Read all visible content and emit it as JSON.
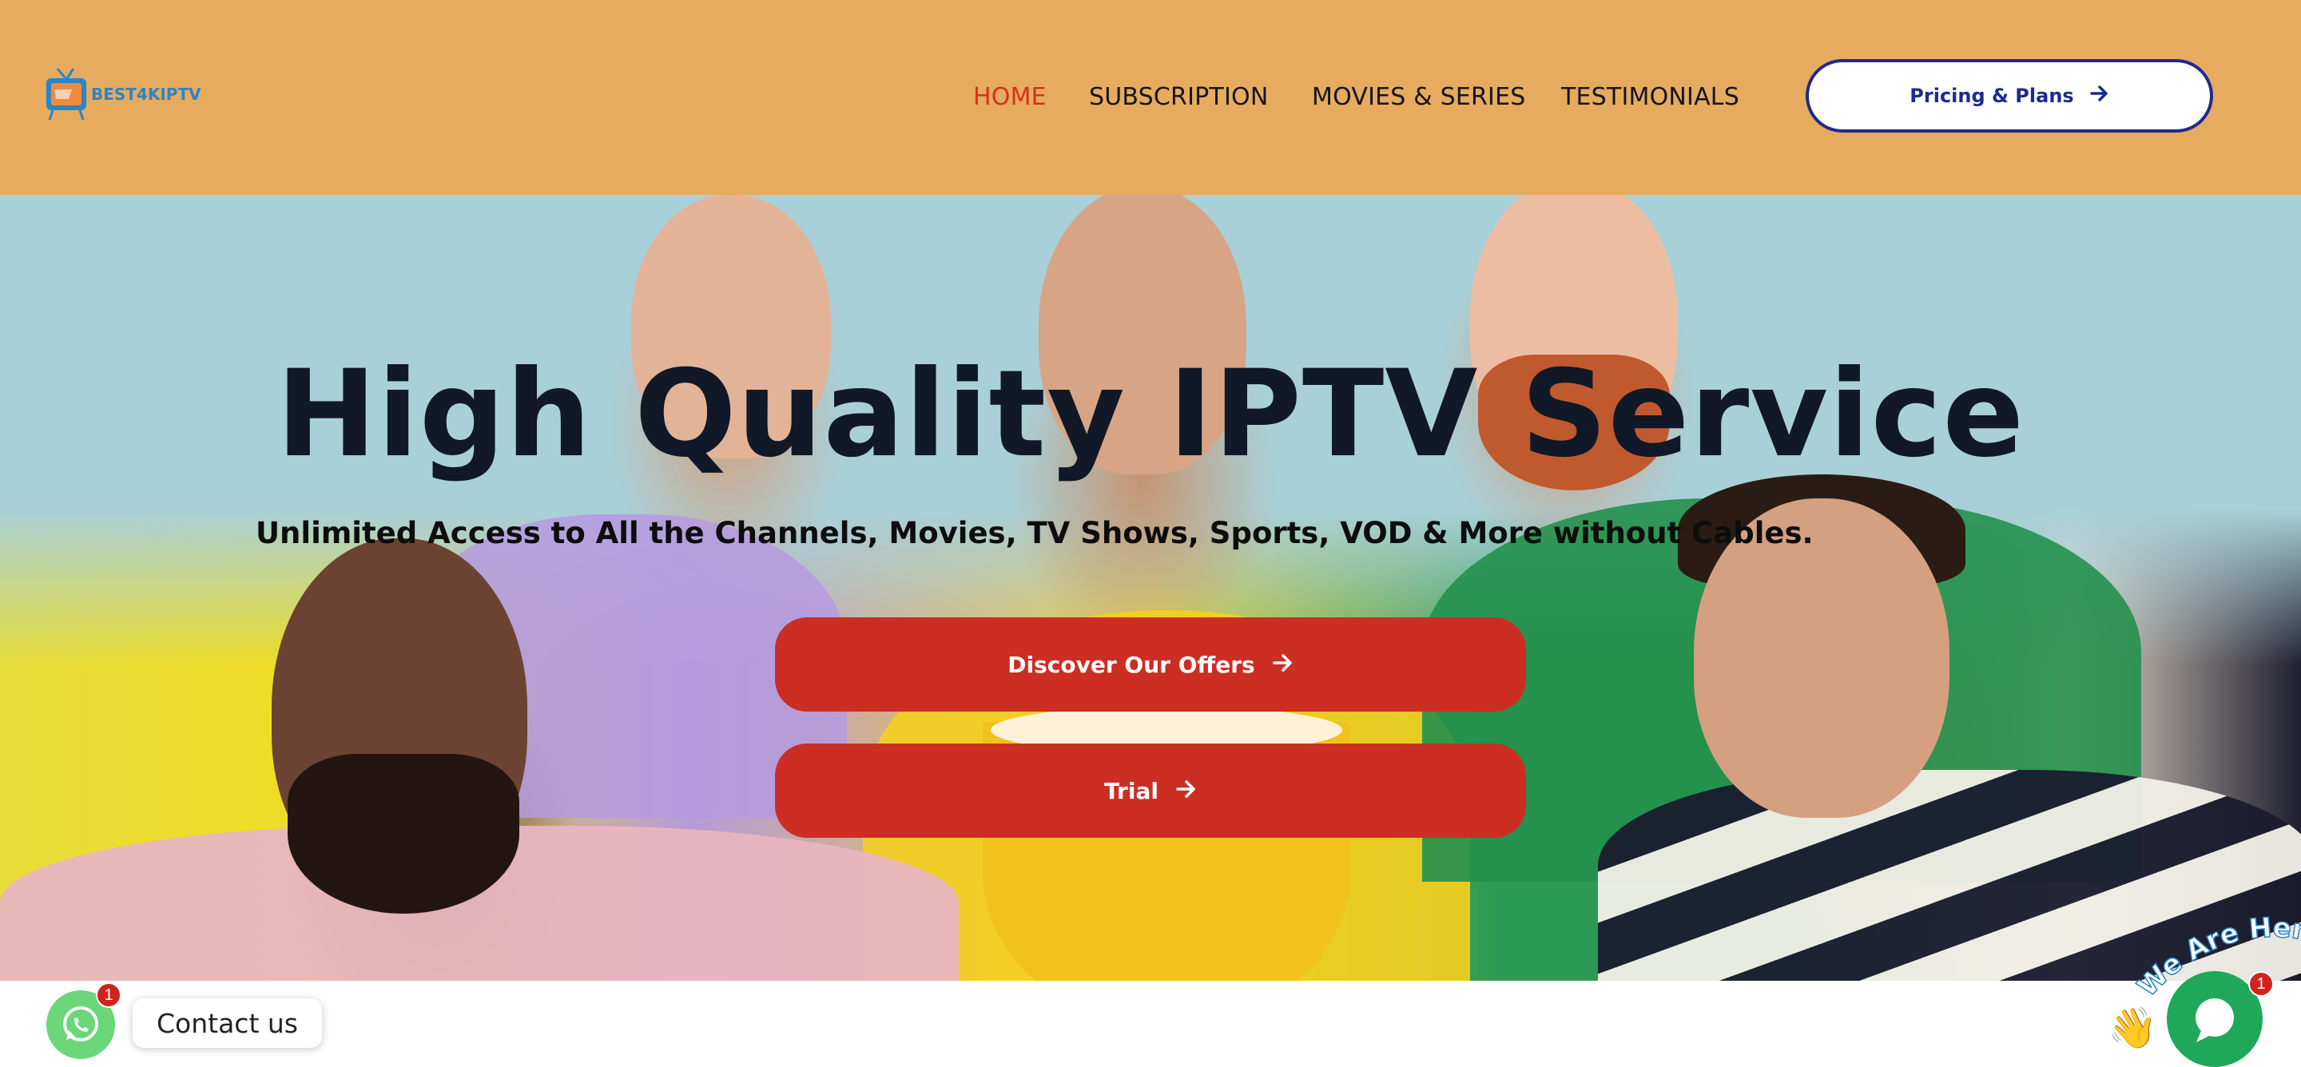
{
  "header": {
    "logo_text": "BEST4KIPTV",
    "nav": [
      {
        "label": "HOME",
        "active": true
      },
      {
        "label": "SUBSCRIPTION",
        "active": false
      },
      {
        "label": "MOVIES & SERIES",
        "active": false
      },
      {
        "label": "TESTIMONIALS",
        "active": false
      }
    ],
    "pricing_button": "Pricing & Plans"
  },
  "hero": {
    "title": "High Quality IPTV Service",
    "subtitle": "Unlimited Access to All the Channels, Movies, TV Shows, Sports, VOD & More without Cables.",
    "cta_primary": "Discover Our Offers",
    "cta_secondary": "Trial"
  },
  "widgets": {
    "whatsapp_badge": "1",
    "contact_label": "Contact us",
    "chat_badge": "1",
    "chat_tagline": "We Are Here!"
  },
  "colors": {
    "header_bg": "#e6ab5e",
    "accent_red": "#cd2e23",
    "active_nav": "#d8301e",
    "pricing_border": "#1e2a8c"
  }
}
